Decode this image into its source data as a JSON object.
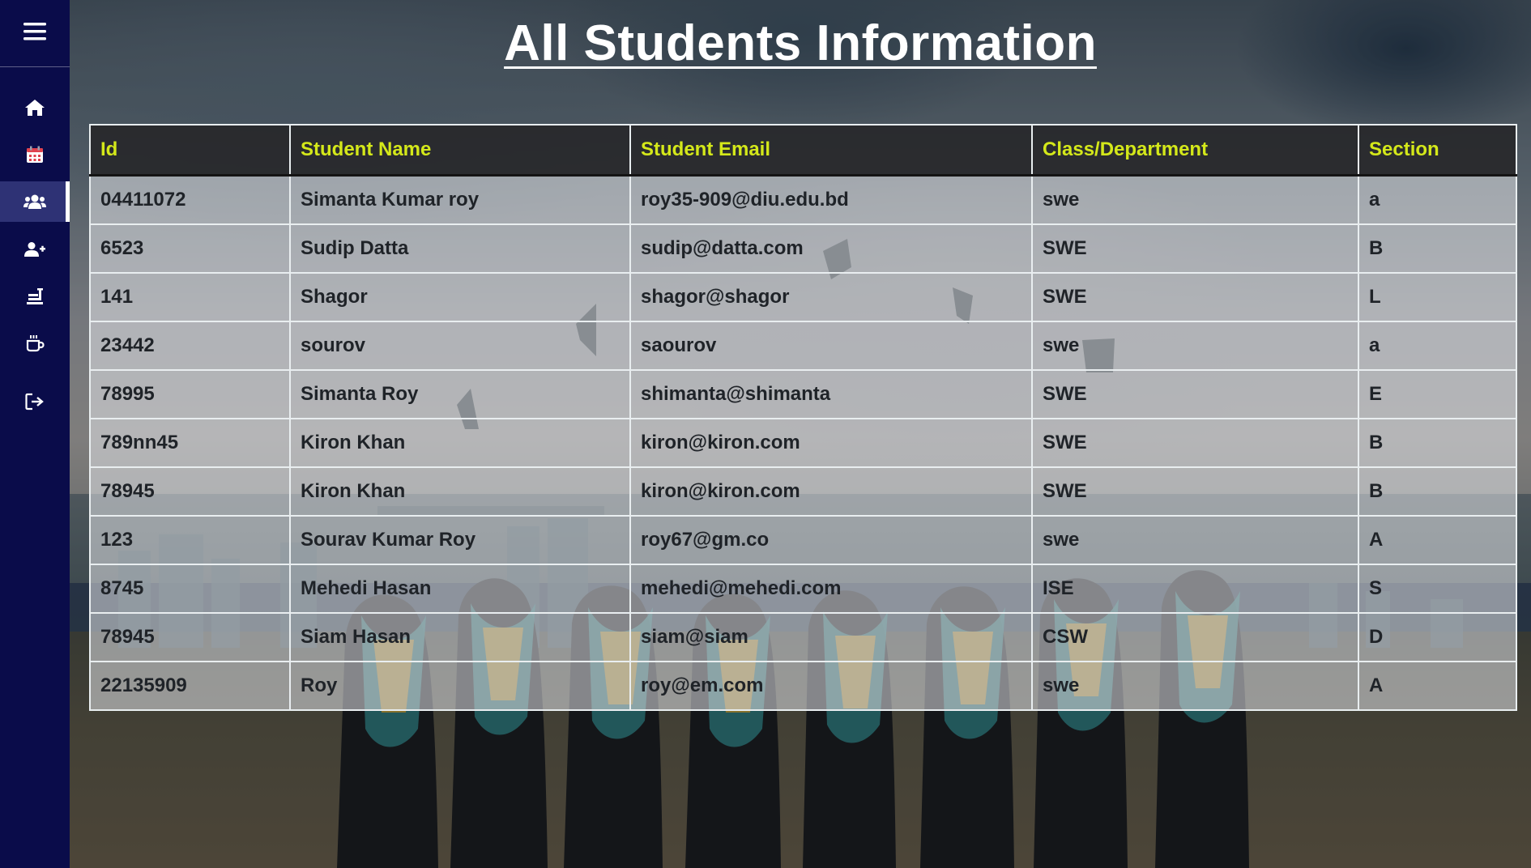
{
  "sidebar": {
    "items": [
      {
        "icon": "home-icon"
      },
      {
        "icon": "calendar-icon"
      },
      {
        "icon": "users-icon",
        "active": true
      },
      {
        "icon": "add-user-icon"
      },
      {
        "icon": "food-icon"
      },
      {
        "icon": "coffee-cup-icon"
      },
      {
        "icon": "logout-icon"
      }
    ]
  },
  "page": {
    "title": "All Students Information"
  },
  "table": {
    "headers": [
      "Id",
      "Student Name",
      "Student Email",
      "Class/Department",
      "Section"
    ],
    "rows": [
      [
        "04411072",
        "Simanta Kumar roy",
        "roy35-909@diu.edu.bd",
        "swe",
        "a"
      ],
      [
        "6523",
        "Sudip Datta",
        "sudip@datta.com",
        "SWE",
        "B"
      ],
      [
        "141",
        "Shagor",
        "shagor@shagor",
        "SWE",
        "L"
      ],
      [
        "23442",
        "sourov",
        "saourov",
        "swe",
        "a"
      ],
      [
        "78995",
        "Simanta Roy",
        "shimanta@shimanta",
        "SWE",
        "E"
      ],
      [
        "789nn45",
        "Kiron Khan",
        "kiron@kiron.com",
        "SWE",
        "B"
      ],
      [
        "78945",
        "Kiron Khan",
        "kiron@kiron.com",
        "SWE",
        "B"
      ],
      [
        "123",
        "Sourav Kumar Roy",
        "roy67@gm.co",
        "swe",
        "A"
      ],
      [
        "8745",
        "Mehedi Hasan",
        "mehedi@mehedi.com",
        "ISE",
        "S"
      ],
      [
        "78945",
        "Siam Hasan",
        "siam@siam",
        "CSW",
        "D"
      ],
      [
        "22135909",
        "Roy",
        "roy@em.com",
        "swe",
        "A"
      ]
    ]
  },
  "colors": {
    "sidebar_bg": "#0a0c4a",
    "sidebar_active": "#2e3275",
    "header_text": "#d4e81a",
    "header_bg": "#262628",
    "cell_text": "#1f2328"
  }
}
